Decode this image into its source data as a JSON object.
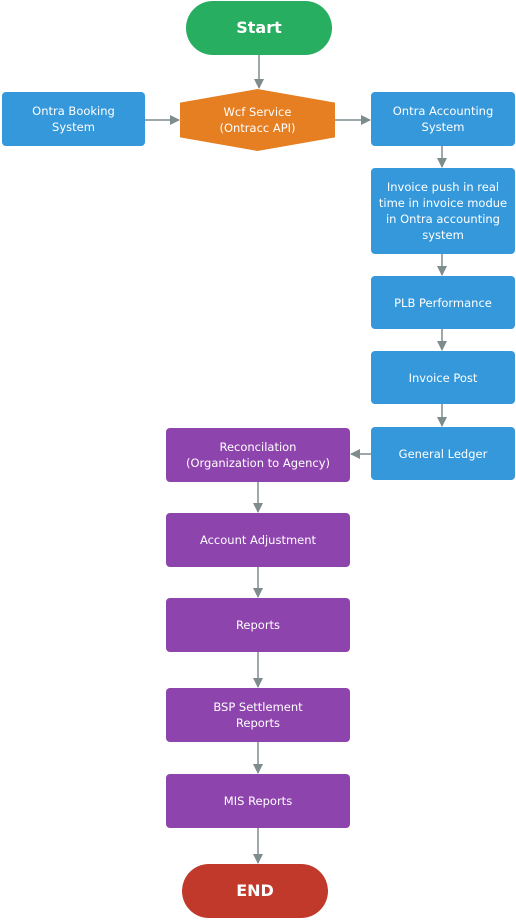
{
  "nodes": {
    "start": "Start",
    "booking": "Ontra Booking\nSystem",
    "wcf": "Wcf Service\n(Ontracc API)",
    "acct": "Ontra Accounting\nSystem",
    "push": "Invoice push in real\ntime in invoice modue\nin Ontra accounting\nsystem",
    "plb": "PLB Performance",
    "post": "Invoice Post",
    "gl": "General Ledger",
    "recon": "Reconcilation\n(Organization to Agency)",
    "adj": "Account Adjustment",
    "reports": "Reports",
    "bsp": "BSP Settlement\nReports",
    "mis": "MIS Reports",
    "end": "END"
  },
  "edges": [
    [
      "start",
      "wcf"
    ],
    [
      "booking",
      "wcf"
    ],
    [
      "wcf",
      "acct"
    ],
    [
      "acct",
      "push"
    ],
    [
      "push",
      "plb"
    ],
    [
      "plb",
      "post"
    ],
    [
      "post",
      "gl"
    ],
    [
      "gl",
      "recon"
    ],
    [
      "recon",
      "adj"
    ],
    [
      "adj",
      "reports"
    ],
    [
      "reports",
      "bsp"
    ],
    [
      "bsp",
      "mis"
    ],
    [
      "mis",
      "end"
    ]
  ],
  "colors": {
    "start": "#27ae60",
    "end": "#c0392b",
    "process": "#3498db",
    "service": "#e67e22",
    "finance": "#8e44ad",
    "arrow": "#7f8c8d"
  }
}
